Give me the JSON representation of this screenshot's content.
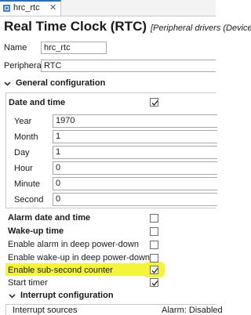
{
  "tab": {
    "label": "hrc_rtc",
    "close": "✕"
  },
  "title": {
    "main": "Real Time Clock (RTC)",
    "sub": "[Peripheral drivers (Device sp"
  },
  "name_field": {
    "label": "Name",
    "value": "hrc_rtc"
  },
  "peripheral_field": {
    "label": "Peripheral",
    "value": "RTC"
  },
  "general": {
    "label": "General configuration"
  },
  "date_time": {
    "label": "Date and time",
    "checked": true,
    "fields": [
      {
        "label": "Year",
        "value": "1970"
      },
      {
        "label": "Month",
        "value": "1"
      },
      {
        "label": "Day",
        "value": "1"
      },
      {
        "label": "Hour",
        "value": "0"
      },
      {
        "label": "Minute",
        "value": "0"
      },
      {
        "label": "Second",
        "value": "0"
      }
    ]
  },
  "options": [
    {
      "label": "Alarm date and time",
      "bold": true,
      "checked": false
    },
    {
      "label": "Wake-up time",
      "bold": true,
      "checked": false
    },
    {
      "label": "Enable alarm in deep power-down",
      "bold": false,
      "checked": false
    },
    {
      "label": "Enable wake-up in deep power-down",
      "bold": false,
      "checked": false
    },
    {
      "label": "Enable sub-second counter",
      "bold": false,
      "checked": true
    },
    {
      "label": "Start timer",
      "bold": false,
      "checked": true
    }
  ],
  "interrupt": {
    "label": "Interrupt configuration",
    "col1": "Interrupt sources",
    "col2": "Alarm: Disabled"
  },
  "colors": {
    "highlight": "#f4f43a",
    "accent": "#2d6fb7"
  }
}
